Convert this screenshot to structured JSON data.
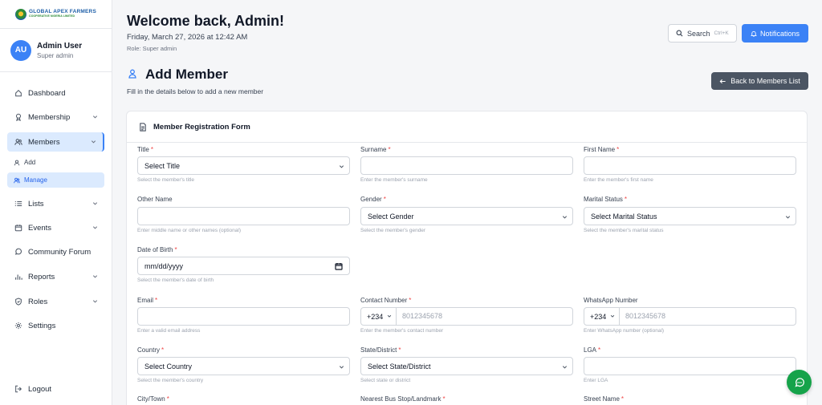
{
  "brand": {
    "line1": "GLOBAL APEX FARMERS",
    "line2": "COOPERATIVE NIGERIA LIMITED"
  },
  "user": {
    "initials": "AU",
    "name": "Admin User",
    "role": "Super admin"
  },
  "nav": {
    "dashboard": "Dashboard",
    "membership": "Membership",
    "members": "Members",
    "add": "Add",
    "manage": "Manage",
    "lists": "Lists",
    "events": "Events",
    "forum": "Community Forum",
    "reports": "Reports",
    "roles": "Roles",
    "settings": "Settings",
    "logout": "Logout"
  },
  "header": {
    "welcome": "Welcome back, Admin!",
    "date": "Friday, March 27, 2026 at 12:42 AM",
    "role": "Role: Super admin",
    "search": "Search",
    "shortcut": "Ctrl+K",
    "notifications": "Notifications"
  },
  "page": {
    "title": "Add Member",
    "subtitle": "Fill in the details below to add a new member",
    "back": "Back to Members List"
  },
  "form": {
    "title": "Member Registration Form",
    "title_field": {
      "label": "Title",
      "value": "Select Title",
      "hint": "Select the member's title"
    },
    "surname": {
      "label": "Surname",
      "hint": "Enter the member's surname"
    },
    "first_name": {
      "label": "First Name",
      "hint": "Enter the member's first name"
    },
    "other_name": {
      "label": "Other Name",
      "hint": "Enter middle name or other names (optional)"
    },
    "gender": {
      "label": "Gender",
      "value": "Select Gender",
      "hint": "Select the member's gender"
    },
    "marital": {
      "label": "Marital Status",
      "value": "Select Marital Status",
      "hint": "Select the member's marital status"
    },
    "dob": {
      "label": "Date of Birth",
      "value": "mm/dd/yyyy",
      "hint": "Select the member's date of birth"
    },
    "email": {
      "label": "Email",
      "hint": "Enter a valid email address"
    },
    "contact": {
      "label": "Contact Number",
      "prefix": "+234",
      "placeholder": "8012345678",
      "hint": "Enter the member's contact number"
    },
    "whatsapp": {
      "label": "WhatsApp Number",
      "prefix": "+234",
      "placeholder": "8012345678",
      "hint": "Enter WhatsApp number (optional)"
    },
    "country": {
      "label": "Country",
      "value": "Select Country",
      "hint": "Select the member's country"
    },
    "state": {
      "label": "State/District",
      "value": "Select State/District",
      "hint": "Select state or district"
    },
    "lga": {
      "label": "LGA",
      "hint": "Enter LGA"
    },
    "city": {
      "label": "City/Town"
    },
    "bus_stop": {
      "label": "Nearest Bus Stop/Landmark"
    },
    "street": {
      "label": "Street Name"
    },
    "required_mark": "*"
  }
}
